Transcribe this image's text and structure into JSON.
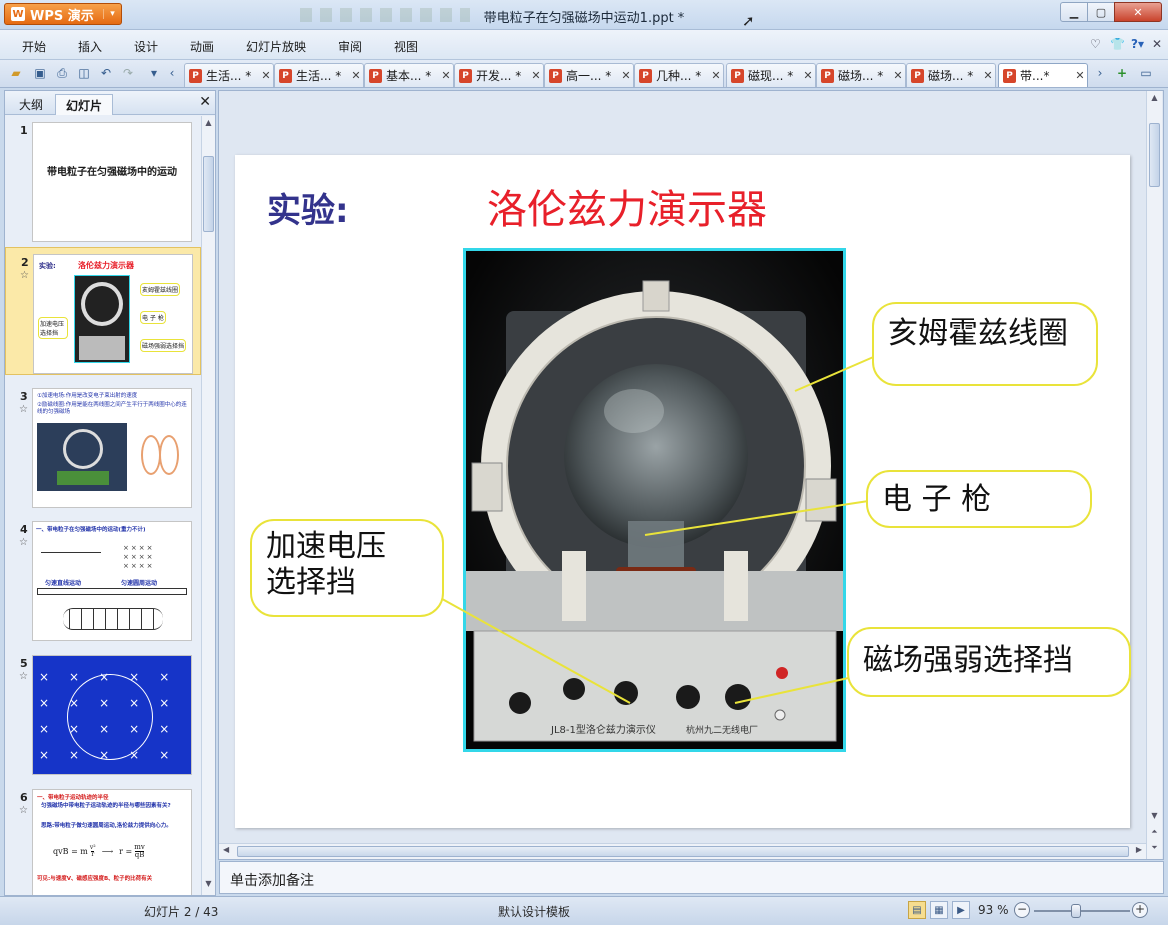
{
  "app": {
    "name": "WPS 演示",
    "doc_title": "带电粒子在匀强磁场中运动1.ppt *"
  },
  "menu": {
    "items": [
      "开始",
      "插入",
      "设计",
      "动画",
      "幻灯片放映",
      "审阅",
      "视图"
    ]
  },
  "tabs": [
    {
      "label": "生活... *",
      "active": false
    },
    {
      "label": "生活... *",
      "active": false
    },
    {
      "label": "基本... *",
      "active": false
    },
    {
      "label": "开发... *",
      "active": false
    },
    {
      "label": "高一... *",
      "active": false
    },
    {
      "label": "几种... *",
      "active": false
    },
    {
      "label": "磁现... *",
      "active": false
    },
    {
      "label": "磁场... *",
      "active": false
    },
    {
      "label": "磁场... *",
      "active": false
    },
    {
      "label": "带...*",
      "active": true
    }
  ],
  "left_pane": {
    "tab_outline": "大纲",
    "tab_slides": "幻灯片",
    "slide_numbers": [
      "1",
      "2",
      "3",
      "4",
      "5",
      "6"
    ],
    "slide1_title": "带电粒子在匀强磁场中的运动",
    "slide2": {
      "exp": "实验:",
      "title": "洛伦兹力演示器",
      "label_coil": "亥姆霍兹线圈",
      "label_gun": "电 子 枪",
      "label_voltage": "加速电压选择挡",
      "label_field": "磁场强弱选择挡"
    },
    "slide3": {
      "line1": "①加速电场:作用是改变电子束出射的速度",
      "line2": "②励磁线圈:作用是能在两线圈之间产生平行于两线圈中心的连线的匀强磁场"
    },
    "slide4": {
      "heading": "一、带电粒子在匀强磁场中的运动(重力不计)",
      "sub1": "匀速直线运动",
      "sub2": "匀速圆周运动"
    },
    "slide6": {
      "heading": "一、带电粒子运动轨迹的半径",
      "q": "匀强磁场中带电粒子运动轨迹的半径与哪些因素有关?",
      "a": "思路:带电粒子做匀速圆周运动,洛伦兹力提供向心力。",
      "eq_left": "qvB = m",
      "eq_frac_num": "v²",
      "eq_frac_den": "r",
      "eq_right": "r =",
      "eq_r_num": "mv",
      "eq_r_den": "qB",
      "conclusion": "可见:与速度V、磁感应强度B、粒子的比荷有关"
    }
  },
  "slide": {
    "exp": "实验:",
    "title": "洛伦兹力演示器",
    "callouts": {
      "coil": "亥姆霍兹线圈",
      "gun": "电    子    枪",
      "voltage_line1": "加速电压",
      "voltage_line2": "选择挡",
      "field": "磁场强弱选择挡"
    },
    "device_label": "JL8-1型洛仑兹力演示仪",
    "maker": "杭州九二无线电厂"
  },
  "notes_placeholder": "单击添加备注",
  "status": {
    "slide_counter": "幻灯片 2 / 43",
    "template": "默认设计模板",
    "zoom": "93 %"
  },
  "colors": {
    "title_red": "#e8202a",
    "exp_blue": "#33338c",
    "photo_border": "#33d7e9",
    "callout_border": "#e9e33a",
    "accent_orange": "#e56a12"
  }
}
